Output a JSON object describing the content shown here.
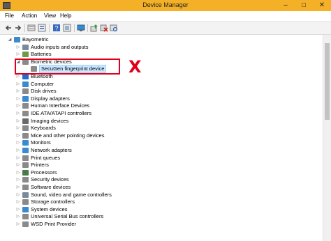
{
  "window": {
    "title": "Device Manager",
    "controls": {
      "minimize": "–",
      "maximize": "□",
      "close": "✕"
    }
  },
  "menu": [
    "File",
    "Action",
    "View",
    "Help"
  ],
  "toolbar": {
    "buttons": [
      "back-arrow-icon",
      "forward-arrow-icon",
      "device-list-icon",
      "properties-icon",
      "help-icon",
      "show-hidden-icon",
      "monitor-icon",
      "update-driver-icon",
      "uninstall-icon",
      "scan-hardware-icon"
    ]
  },
  "tree": {
    "root": "Bayometric",
    "items": [
      {
        "label": "Audio inputs and outputs",
        "icon": "speaker-icon",
        "color": "#7a8a9a"
      },
      {
        "label": "Batteries",
        "icon": "battery-icon",
        "color": "#6a9a4a"
      },
      {
        "label": "Biometric devices",
        "icon": "fingerprint-icon",
        "color": "#8a8a8a",
        "expanded": true,
        "children": [
          {
            "label": "SecuGen fingerprint device",
            "icon": "fingerprint-icon",
            "color": "#8a8a8a"
          }
        ]
      },
      {
        "label": "Bluetooth",
        "icon": "bluetooth-icon",
        "color": "#1e6fd0"
      },
      {
        "label": "Computer",
        "icon": "computer-icon",
        "color": "#3a8ad0"
      },
      {
        "label": "Disk drives",
        "icon": "disk-icon",
        "color": "#8a8a8a"
      },
      {
        "label": "Display adapters",
        "icon": "display-icon",
        "color": "#3a8ad0"
      },
      {
        "label": "Human Interface Devices",
        "icon": "hid-icon",
        "color": "#8a8a8a"
      },
      {
        "label": "IDE ATA/ATAPI controllers",
        "icon": "controller-icon",
        "color": "#8a8a8a"
      },
      {
        "label": "Imaging devices",
        "icon": "camera-icon",
        "color": "#6a6a6a"
      },
      {
        "label": "Keyboards",
        "icon": "keyboard-icon",
        "color": "#8a8a8a"
      },
      {
        "label": "Mice and other pointing devices",
        "icon": "mouse-icon",
        "color": "#8a8a8a"
      },
      {
        "label": "Monitors",
        "icon": "monitor-icon",
        "color": "#3a8ad0"
      },
      {
        "label": "Network adapters",
        "icon": "network-icon",
        "color": "#3a8ad0"
      },
      {
        "label": "Print queues",
        "icon": "printer-icon",
        "color": "#8a8a8a"
      },
      {
        "label": "Printers",
        "icon": "printer-icon",
        "color": "#8a8a8a"
      },
      {
        "label": "Processors",
        "icon": "processor-icon",
        "color": "#4a7a4a"
      },
      {
        "label": "Security devices",
        "icon": "security-icon",
        "color": "#8a8a8a"
      },
      {
        "label": "Software devices",
        "icon": "software-icon",
        "color": "#8a8a8a"
      },
      {
        "label": "Sound, video and game controllers",
        "icon": "sound-icon",
        "color": "#7a8a9a"
      },
      {
        "label": "Storage controllers",
        "icon": "storage-icon",
        "color": "#8a8a8a"
      },
      {
        "label": "System devices",
        "icon": "system-icon",
        "color": "#3a8ad0"
      },
      {
        "label": "Universal Serial Bus controllers",
        "icon": "usb-icon",
        "color": "#8a8a8a"
      },
      {
        "label": "WSD Print Provider",
        "icon": "printer-icon",
        "color": "#8a8a8a"
      }
    ]
  },
  "annotation": {
    "mark": "X",
    "color": "#e0001b"
  },
  "colors": {
    "titlebar": "#f4b128",
    "selection": "#cce8ff",
    "annotation": "#e0001b"
  }
}
